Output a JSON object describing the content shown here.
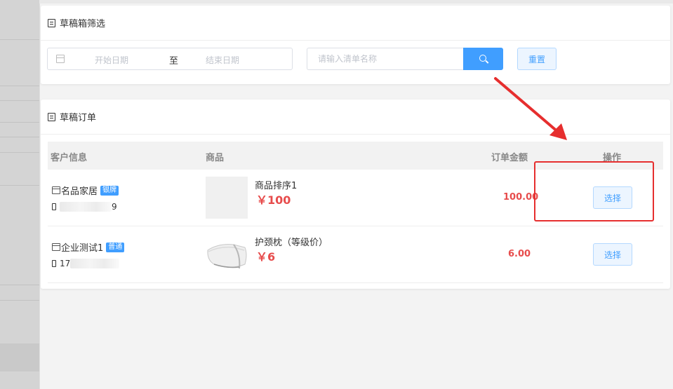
{
  "filter_panel": {
    "title": "草稿箱筛选",
    "date_start_placeholder": "开始日期",
    "date_separator": "至",
    "date_end_placeholder": "结束日期",
    "search_placeholder": "请输入清单名称",
    "reset_label": "重置"
  },
  "orders_panel": {
    "title": "草稿订单",
    "columns": [
      "客户信息",
      "商品",
      "订单金额",
      "操作"
    ],
    "rows": [
      {
        "customer": "名品家居",
        "level_badge": "银牌",
        "phone_prefix": "",
        "phone_suffix": "9",
        "product_name": "商品排序1",
        "product_price": "￥100",
        "amount": "100.00",
        "action": "选择"
      },
      {
        "customer": "企业测试1",
        "level_badge": "普通",
        "phone_prefix": "17",
        "phone_suffix": "",
        "product_name": "护颈枕（等级价）",
        "product_price": "￥6",
        "amount": "6.00",
        "action": "选择"
      }
    ]
  },
  "colors": {
    "primary": "#409eff",
    "price_red": "#e74c4c",
    "annotation_red": "#e62e2e"
  }
}
